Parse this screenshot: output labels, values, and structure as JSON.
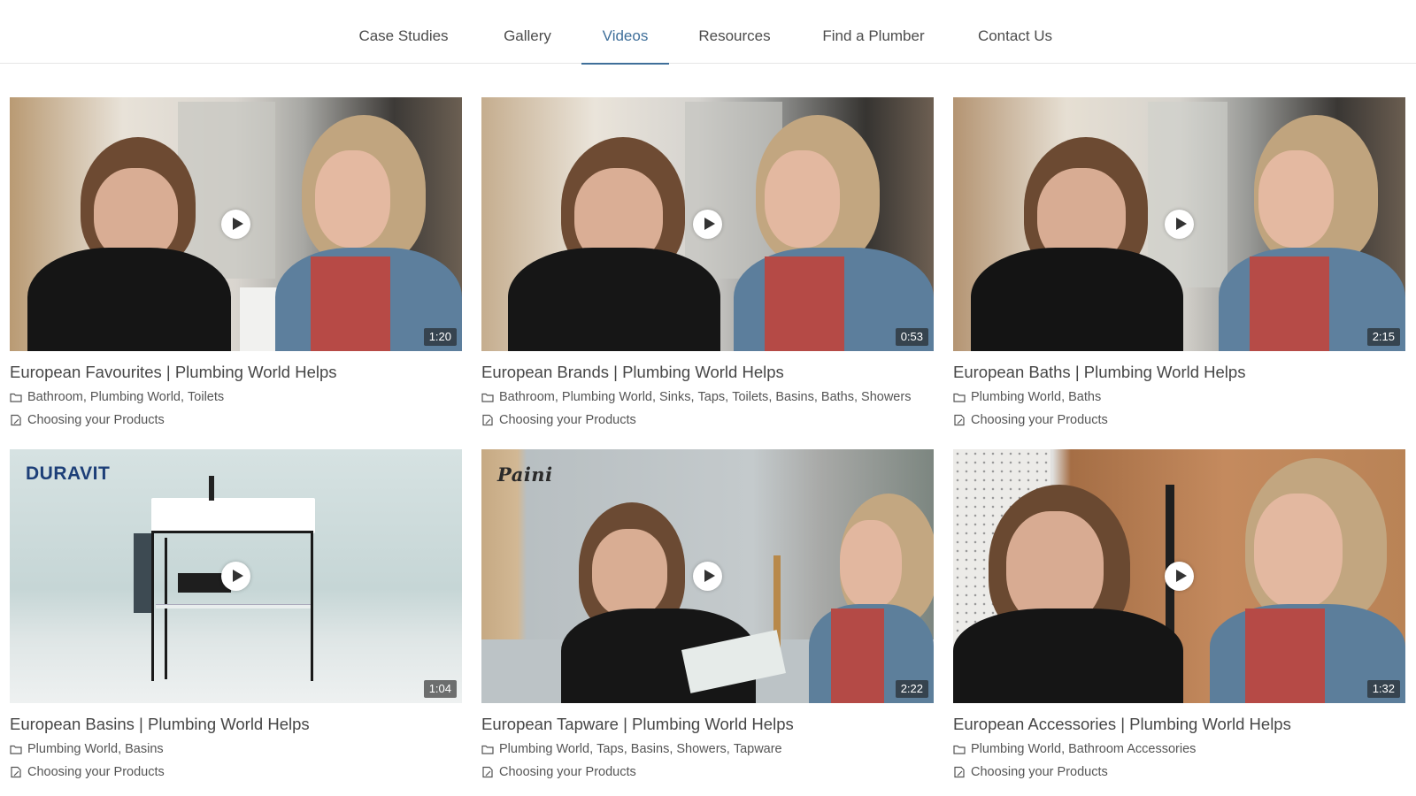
{
  "nav": {
    "items": [
      {
        "label": "Case Studies",
        "active": false
      },
      {
        "label": "Gallery",
        "active": false
      },
      {
        "label": "Videos",
        "active": true
      },
      {
        "label": "Resources",
        "active": false
      },
      {
        "label": "Find a Plumber",
        "active": false
      },
      {
        "label": "Contact Us",
        "active": false
      }
    ],
    "active_color": "#3f6f9a"
  },
  "videos": [
    {
      "title": "European Favourites | Plumbing World Helps",
      "duration": "1:20",
      "categories": [
        "Bathroom",
        "Plumbing World",
        "Toilets"
      ],
      "topic": "Choosing your Products"
    },
    {
      "title": "European Brands | Plumbing World Helps",
      "duration": "0:53",
      "categories": [
        "Bathroom",
        "Plumbing World",
        "Sinks",
        "Taps",
        "Toilets",
        "Basins",
        "Baths",
        "Showers"
      ],
      "topic": "Choosing your Products"
    },
    {
      "title": "European Baths | Plumbing World Helps",
      "duration": "2:15",
      "categories": [
        "Plumbing World",
        "Baths"
      ],
      "topic": "Choosing your Products"
    },
    {
      "title": "European Basins | Plumbing World Helps",
      "duration": "1:04",
      "categories": [
        "Plumbing World",
        "Basins"
      ],
      "topic": "Choosing your Products",
      "logo": "DURAVIT"
    },
    {
      "title": "European Tapware | Plumbing World Helps",
      "duration": "2:22",
      "categories": [
        "Plumbing World",
        "Taps",
        "Basins",
        "Showers",
        "Tapware"
      ],
      "topic": "Choosing your Products",
      "logo": "Paini"
    },
    {
      "title": "European Accessories | Plumbing World Helps",
      "duration": "1:32",
      "categories": [
        "Plumbing World",
        "Bathroom Accessories"
      ],
      "topic": "Choosing your Products"
    }
  ]
}
